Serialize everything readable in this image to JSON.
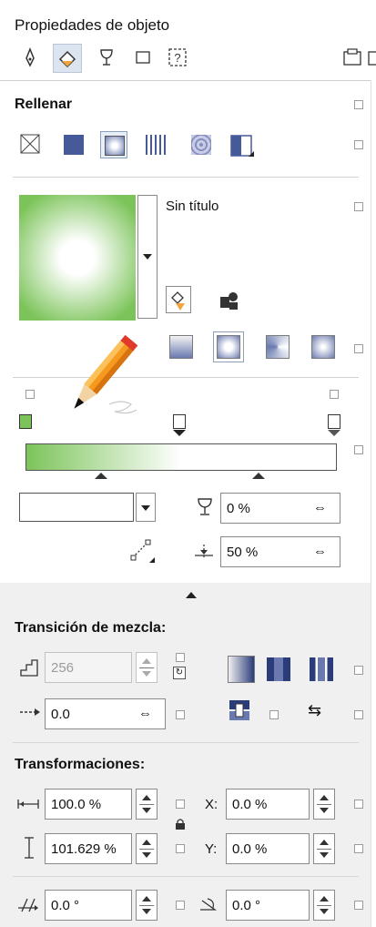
{
  "panel": {
    "title": "Propiedades de objeto"
  },
  "fill": {
    "section_label": "Rellenar",
    "preset_name": "Sin título",
    "colors": {
      "start": "#7cc45a",
      "end": "#ffffff"
    },
    "opacity_value": "0 %",
    "midpoint_value": "50 %"
  },
  "blend": {
    "section_label": "Transición de mezcla:",
    "steps_value": "256",
    "acceleration_value": "0.0"
  },
  "transform": {
    "section_label": "Transformaciones:",
    "width_value": "100.0 %",
    "height_value": "101.629 %",
    "x_label": "X:",
    "x_value": "0.0 %",
    "y_label": "Y:",
    "y_value": "0.0 %",
    "skew_value": "0.0 °",
    "rotate_value": "0.0 °"
  },
  "icons": [
    "pen-icon",
    "fill-bucket-icon",
    "transparency-glass-icon",
    "frame-icon",
    "text-frame-icon",
    "panel-menu-icon",
    "pencil-illustration"
  ]
}
